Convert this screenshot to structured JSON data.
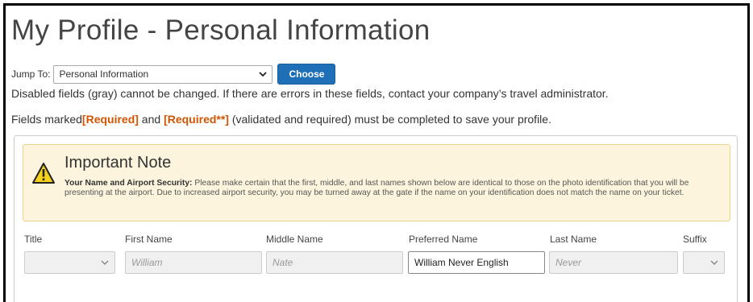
{
  "page": {
    "title": "My Profile - Personal Information"
  },
  "jump": {
    "label": "Jump To:",
    "selected": "Personal Information",
    "choose_label": "Choose"
  },
  "notes": {
    "disabled": "Disabled fields (gray) cannot be changed. If there are errors in these fields, contact your company’s travel administrator.",
    "required_prefix": "Fields marked",
    "required_tag": "[Required]",
    "required_and": " and ",
    "required_tag2": "[Required**]",
    "required_suffix": " (validated and required) must be completed to save your profile."
  },
  "alert": {
    "title": "Important Note",
    "bold": "Your Name and Airport Security:",
    "body": " Please make certain that the first, middle, and last names shown below are identical to those on the photo identification that you will be presenting at the airport. Due to increased airport security, you may be turned away at the gate if the name on your identification does not match the name on your ticket."
  },
  "fields": {
    "title_label": "Title",
    "first_label": "First Name",
    "first_value": "William",
    "middle_label": "Middle Name",
    "middle_value": "Nate",
    "preferred_label": "Preferred Name",
    "preferred_value": "William Never English",
    "last_label": "Last Name",
    "last_value": "Never",
    "suffix_label": "Suffix"
  },
  "colors": {
    "accent_button": "#1f6fb6",
    "required_text": "#d35400",
    "alert_bg": "#fcf4dc"
  }
}
